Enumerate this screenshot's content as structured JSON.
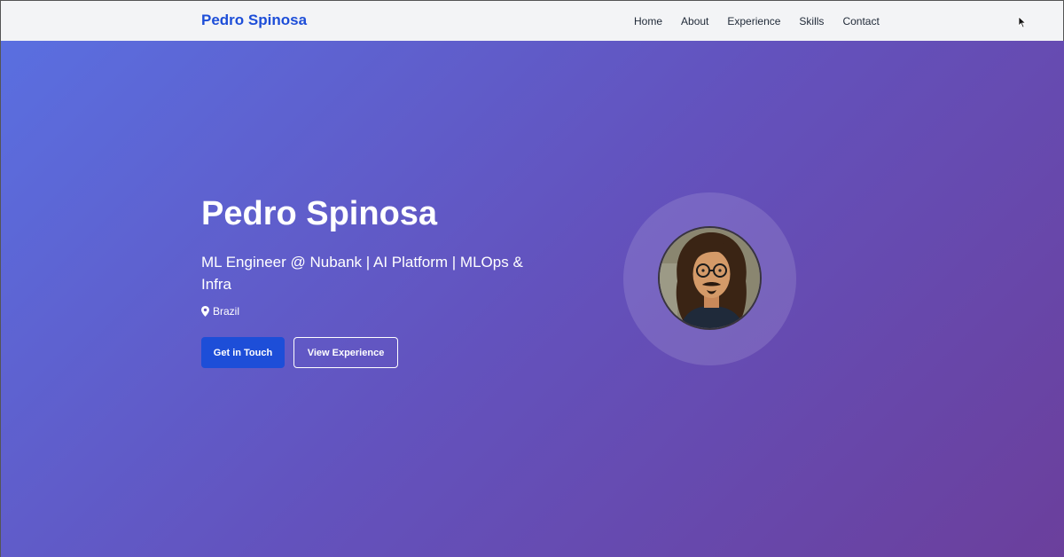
{
  "nav": {
    "brand": "Pedro Spinosa",
    "links": [
      "Home",
      "About",
      "Experience",
      "Skills",
      "Contact"
    ]
  },
  "hero": {
    "title": "Pedro Spinosa",
    "subtitle": "ML Engineer @ Nubank | AI Platform | MLOps & Infra",
    "location": "Brazil",
    "primary_button": "Get in Touch",
    "secondary_button": "View Experience"
  },
  "icons": {
    "location": "map-pin-icon",
    "cursor": "mouse-pointer"
  },
  "colors": {
    "brand": "#1d4ed8",
    "navbar_bg": "#f3f4f6",
    "hero_gradient_start": "#5a6fe0",
    "hero_gradient_end": "#6b3f9c",
    "button_primary": "#1d4ed8"
  }
}
